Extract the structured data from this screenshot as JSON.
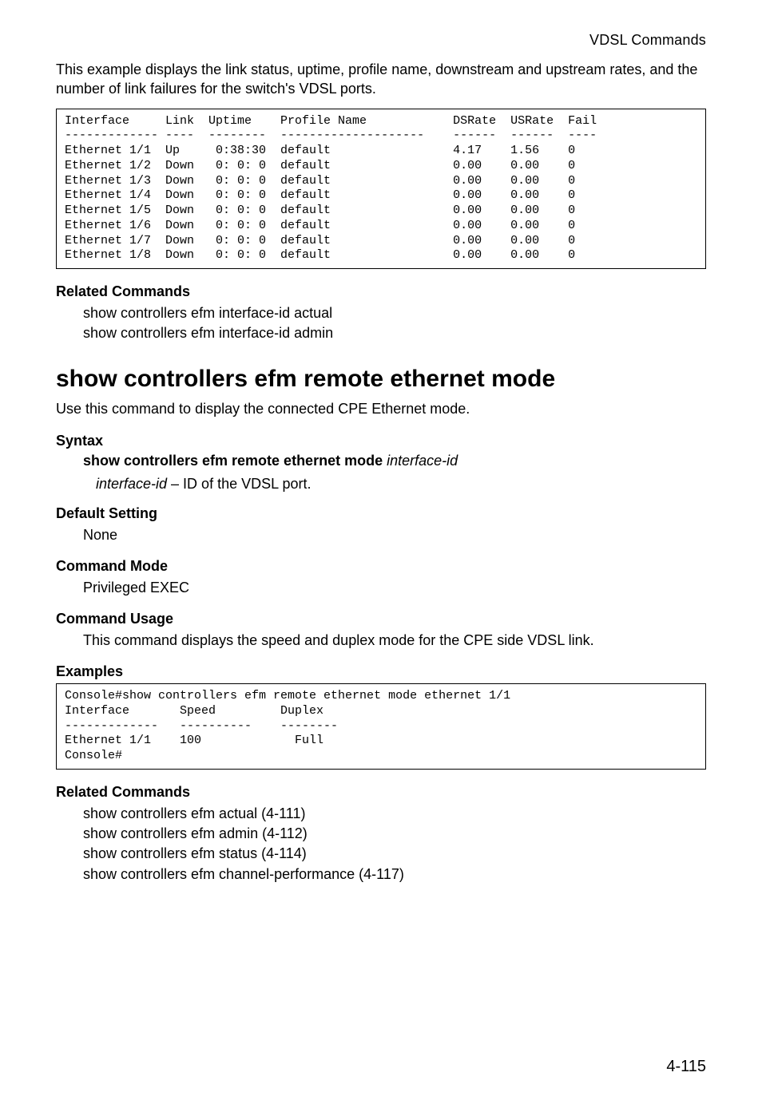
{
  "header": {
    "section": "VDSL Commands"
  },
  "intro": "This example displays the link status, uptime, profile name, downstream and upstream rates, and the number of link failures for the switch's VDSL ports.",
  "table1": {
    "header": "Interface     Link  Uptime    Profile Name            DSRate  USRate  Fail",
    "sep": "------------- ----  --------  --------------------    ------  ------  ----",
    "rows": [
      "Ethernet 1/1  Up     0:38:30  default                 4.17    1.56    0",
      "Ethernet 1/2  Down   0: 0: 0  default                 0.00    0.00    0",
      "Ethernet 1/3  Down   0: 0: 0  default                 0.00    0.00    0",
      "Ethernet 1/4  Down   0: 0: 0  default                 0.00    0.00    0",
      "Ethernet 1/5  Down   0: 0: 0  default                 0.00    0.00    0",
      "Ethernet 1/6  Down   0: 0: 0  default                 0.00    0.00    0",
      "Ethernet 1/7  Down   0: 0: 0  default                 0.00    0.00    0",
      "Ethernet 1/8  Down   0: 0: 0  default                 0.00    0.00    0"
    ]
  },
  "related1": {
    "heading": "Related Commands",
    "lines": [
      "show controllers efm interface-id actual",
      "show controllers efm interface-id admin"
    ]
  },
  "cmd": {
    "title": "show controllers efm remote ethernet mode",
    "desc": "Use this command to display the connected CPE Ethernet mode."
  },
  "syntax": {
    "heading": "Syntax",
    "bold": "show controllers efm remote ethernet mode ",
    "ital": "interface-id",
    "param_ital": "interface-id",
    "param_text": " – ID of the VDSL port."
  },
  "default_setting": {
    "heading": "Default Setting",
    "value": "None"
  },
  "command_mode": {
    "heading": "Command Mode",
    "value": "Privileged EXEC"
  },
  "command_usage": {
    "heading": "Command Usage",
    "value": "This command displays the speed and duplex mode for the CPE side VDSL link."
  },
  "examples": {
    "heading": "Examples",
    "line1": "Console#show controllers efm remote ethernet mode ethernet 1/1",
    "line2": "Interface       Speed         Duplex",
    "line3": "-------------   ----------    --------",
    "line4": "Ethernet 1/1    100             Full",
    "line5": "Console#"
  },
  "related2": {
    "heading": "Related Commands",
    "lines": [
      "show controllers efm actual (4-111)",
      "show controllers efm admin (4-112)",
      "show controllers efm status (4-114)",
      "show controllers efm channel-performance (4-117)"
    ]
  },
  "page_number": "4-115"
}
